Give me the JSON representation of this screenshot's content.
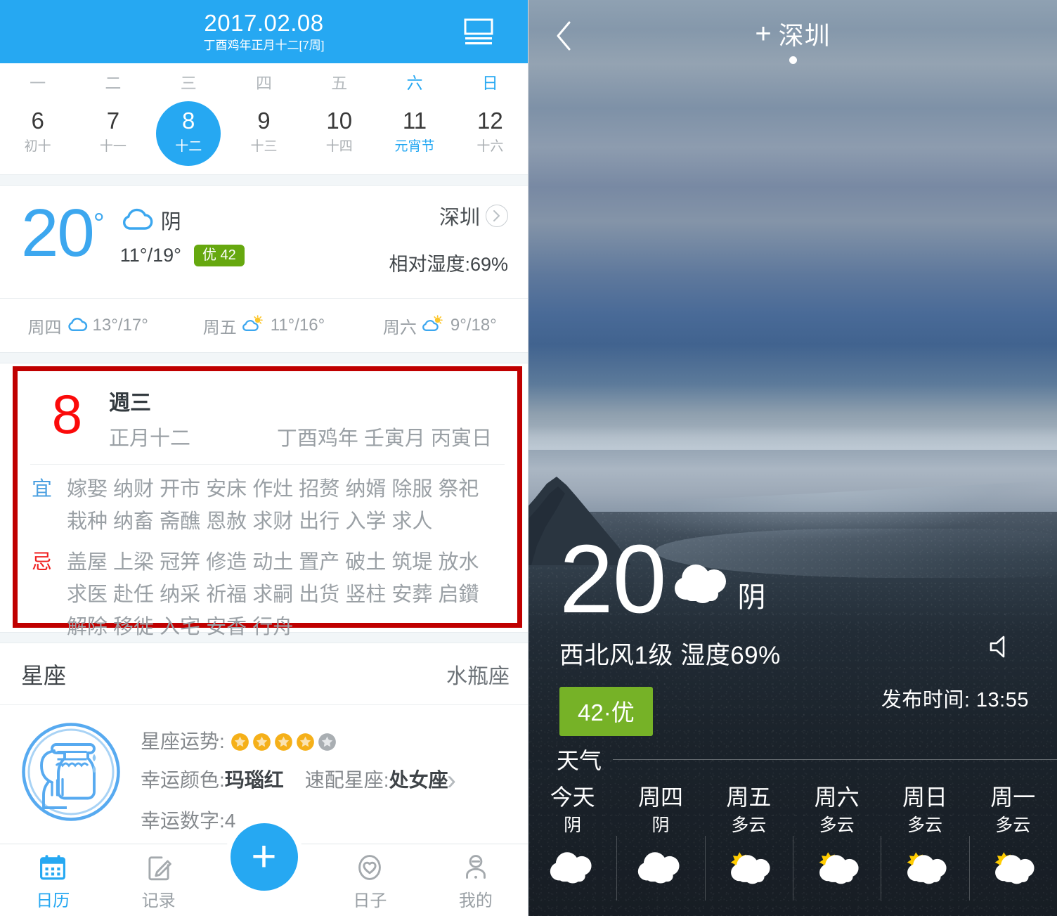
{
  "calendar": {
    "header": {
      "date": "2017.02.08",
      "lunar_line": "丁酉鸡年正月十二[7周]",
      "agenda_icon": "agenda-view-icon"
    },
    "weekday_labels": [
      "一",
      "二",
      "三",
      "四",
      "五",
      "六",
      "日"
    ],
    "days": [
      {
        "num": "6",
        "lunar": "初十",
        "selected": false,
        "festival": false
      },
      {
        "num": "7",
        "lunar": "十一",
        "selected": false,
        "festival": false
      },
      {
        "num": "8",
        "lunar": "十二",
        "selected": true,
        "festival": false
      },
      {
        "num": "9",
        "lunar": "十三",
        "selected": false,
        "festival": false
      },
      {
        "num": "10",
        "lunar": "十四",
        "selected": false,
        "festival": false
      },
      {
        "num": "11",
        "lunar": "元宵节",
        "selected": false,
        "festival": true
      },
      {
        "num": "12",
        "lunar": "十六",
        "selected": false,
        "festival": false
      }
    ],
    "weather": {
      "temp": "20",
      "degree": "°",
      "condition": "阴",
      "low_high": "11°/19°",
      "aqi_label": "优",
      "aqi_value": "42",
      "city": "深圳",
      "humidity": "相对湿度:69%",
      "forecast": [
        {
          "day": "周四",
          "icon": "cloudy-icon",
          "temp": "13°/17°"
        },
        {
          "day": "周五",
          "icon": "partly-sunny-icon",
          "temp": "11°/16°"
        },
        {
          "day": "周六",
          "icon": "partly-sunny-icon",
          "temp": "9°/18°"
        }
      ]
    },
    "almanac": {
      "day": "8",
      "weekday": "週三",
      "lunar": "正月十二",
      "ganzhi": "丁酉鸡年 壬寅月 丙寅日",
      "yi_label": "宜",
      "yi_line1": "嫁娶 纳财 开市 安床 作灶 招赘 纳婿 除服 祭祀",
      "yi_line2": "栽种 纳畜 斋醮 恩赦 求财 出行 入学 求人",
      "ji_label": "忌",
      "ji_line1": "盖屋 上梁 冠笄 修造 动土 置产 破土 筑堤 放水",
      "ji_line2": "求医 赴任 纳采 祈福 求嗣 出货 竖柱 安葬 启鑽",
      "ji_line3": "解除 移徙 入宅 安香 行舟",
      "highlight_color": "#c00000"
    },
    "zodiac": {
      "section_title": "星座",
      "sign": "水瓶座",
      "icon": "aquarius-icon",
      "fortune_label": "星座运势:",
      "stars_filled": 4,
      "stars_total": 5,
      "lucky_color_label": "幸运颜色:",
      "lucky_color_value": "玛瑙红",
      "match_label": "速配星座:",
      "match_value": "处女座",
      "lucky_number_label": "幸运数字:",
      "lucky_number_value": "4"
    },
    "tabbar": [
      {
        "label": "日历",
        "icon": "calendar-icon",
        "active": true
      },
      {
        "label": "记录",
        "icon": "note-pencil-icon",
        "active": false
      },
      {
        "label": "",
        "icon": "add-fab-icon",
        "active": false
      },
      {
        "label": "日子",
        "icon": "heart-shield-icon",
        "active": false
      },
      {
        "label": "我的",
        "icon": "user-icon",
        "active": false
      }
    ],
    "fab_label": "+"
  },
  "weather_app": {
    "back_icon": "back-chevron-icon",
    "add_icon": "plus-icon",
    "city": "深圳",
    "temp": "20",
    "condition_icon": "cloudy-icon",
    "condition": "阴",
    "wind_humidity": "西北风1级 湿度69%",
    "aqi_chip": "42·优",
    "speaker_icon": "speaker-icon",
    "publish_time": "发布时间: 13:55",
    "forecast_title": "天气",
    "forecast": [
      {
        "day": "今天",
        "cond": "阴",
        "icon": "cloudy-icon"
      },
      {
        "day": "周四",
        "cond": "阴",
        "icon": "cloudy-icon"
      },
      {
        "day": "周五",
        "cond": "多云",
        "icon": "partly-cloudy-icon"
      },
      {
        "day": "周六",
        "cond": "多云",
        "icon": "partly-cloudy-icon"
      },
      {
        "day": "周日",
        "cond": "多云",
        "icon": "partly-cloudy-icon"
      },
      {
        "day": "周一",
        "cond": "多云",
        "icon": "partly-cloudy-icon"
      }
    ],
    "colors": {
      "aqi_green": "#76b227",
      "accent_blue": "#26a8f2"
    }
  }
}
